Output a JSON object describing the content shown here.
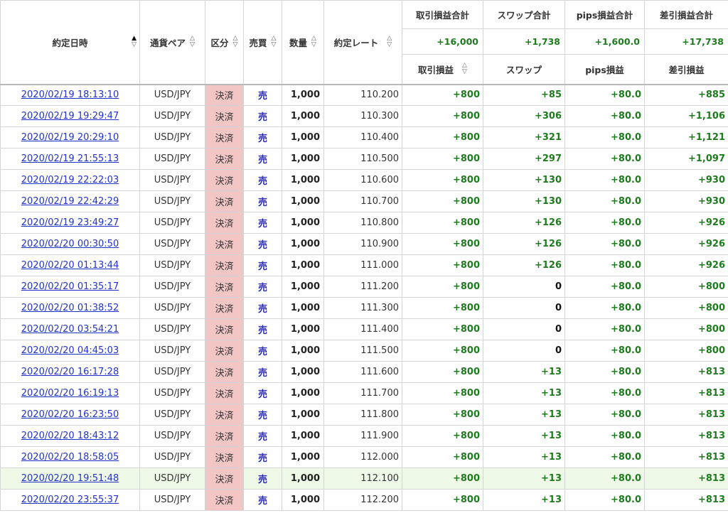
{
  "headers": {
    "date": "約定日時",
    "pair": "通貨ペア",
    "kubun": "区分",
    "baibai": "売買",
    "qty": "数量",
    "rate": "約定レート",
    "trade_pl_total": "取引損益合計",
    "swap_total": "スワップ合計",
    "pips_total": "pips損益合計",
    "net_total": "差引損益合計",
    "trade_pl": "取引損益",
    "swap": "スワップ",
    "pips": "pips損益",
    "net": "差引損益"
  },
  "sort_glyphs": {
    "up": "△",
    "down": "▽",
    "up_active": "▲"
  },
  "totals": {
    "trade_pl": "+16,000",
    "swap": "+1,738",
    "pips": "+1,600.0",
    "net": "+17,738"
  },
  "rows": [
    {
      "date": "2020/02/19 18:13:10",
      "pair": "USD/JPY",
      "kubun": "決済",
      "side": "売",
      "qty": "1,000",
      "rate": "110.200",
      "pl": "+800",
      "swap": "+85",
      "pips": "+80.0",
      "net": "+885"
    },
    {
      "date": "2020/02/19 19:29:47",
      "pair": "USD/JPY",
      "kubun": "決済",
      "side": "売",
      "qty": "1,000",
      "rate": "110.300",
      "pl": "+800",
      "swap": "+306",
      "pips": "+80.0",
      "net": "+1,106"
    },
    {
      "date": "2020/02/19 20:29:10",
      "pair": "USD/JPY",
      "kubun": "決済",
      "side": "売",
      "qty": "1,000",
      "rate": "110.400",
      "pl": "+800",
      "swap": "+321",
      "pips": "+80.0",
      "net": "+1,121"
    },
    {
      "date": "2020/02/19 21:55:13",
      "pair": "USD/JPY",
      "kubun": "決済",
      "side": "売",
      "qty": "1,000",
      "rate": "110.500",
      "pl": "+800",
      "swap": "+297",
      "pips": "+80.0",
      "net": "+1,097"
    },
    {
      "date": "2020/02/19 22:22:03",
      "pair": "USD/JPY",
      "kubun": "決済",
      "side": "売",
      "qty": "1,000",
      "rate": "110.600",
      "pl": "+800",
      "swap": "+130",
      "pips": "+80.0",
      "net": "+930"
    },
    {
      "date": "2020/02/19 22:42:29",
      "pair": "USD/JPY",
      "kubun": "決済",
      "side": "売",
      "qty": "1,000",
      "rate": "110.700",
      "pl": "+800",
      "swap": "+130",
      "pips": "+80.0",
      "net": "+930"
    },
    {
      "date": "2020/02/19 23:49:27",
      "pair": "USD/JPY",
      "kubun": "決済",
      "side": "売",
      "qty": "1,000",
      "rate": "110.800",
      "pl": "+800",
      "swap": "+126",
      "pips": "+80.0",
      "net": "+926"
    },
    {
      "date": "2020/02/20 00:30:50",
      "pair": "USD/JPY",
      "kubun": "決済",
      "side": "売",
      "qty": "1,000",
      "rate": "110.900",
      "pl": "+800",
      "swap": "+126",
      "pips": "+80.0",
      "net": "+926"
    },
    {
      "date": "2020/02/20 01:13:44",
      "pair": "USD/JPY",
      "kubun": "決済",
      "side": "売",
      "qty": "1,000",
      "rate": "111.000",
      "pl": "+800",
      "swap": "+126",
      "pips": "+80.0",
      "net": "+926"
    },
    {
      "date": "2020/02/20 01:35:17",
      "pair": "USD/JPY",
      "kubun": "決済",
      "side": "売",
      "qty": "1,000",
      "rate": "111.200",
      "pl": "+800",
      "swap": "0",
      "pips": "+80.0",
      "net": "+800"
    },
    {
      "date": "2020/02/20 01:38:52",
      "pair": "USD/JPY",
      "kubun": "決済",
      "side": "売",
      "qty": "1,000",
      "rate": "111.300",
      "pl": "+800",
      "swap": "0",
      "pips": "+80.0",
      "net": "+800"
    },
    {
      "date": "2020/02/20 03:54:21",
      "pair": "USD/JPY",
      "kubun": "決済",
      "side": "売",
      "qty": "1,000",
      "rate": "111.400",
      "pl": "+800",
      "swap": "0",
      "pips": "+80.0",
      "net": "+800"
    },
    {
      "date": "2020/02/20 04:45:03",
      "pair": "USD/JPY",
      "kubun": "決済",
      "side": "売",
      "qty": "1,000",
      "rate": "111.500",
      "pl": "+800",
      "swap": "0",
      "pips": "+80.0",
      "net": "+800"
    },
    {
      "date": "2020/02/20 16:17:28",
      "pair": "USD/JPY",
      "kubun": "決済",
      "side": "売",
      "qty": "1,000",
      "rate": "111.600",
      "pl": "+800",
      "swap": "+13",
      "pips": "+80.0",
      "net": "+813"
    },
    {
      "date": "2020/02/20 16:19:13",
      "pair": "USD/JPY",
      "kubun": "決済",
      "side": "売",
      "qty": "1,000",
      "rate": "111.700",
      "pl": "+800",
      "swap": "+13",
      "pips": "+80.0",
      "net": "+813"
    },
    {
      "date": "2020/02/20 16:23:50",
      "pair": "USD/JPY",
      "kubun": "決済",
      "side": "売",
      "qty": "1,000",
      "rate": "111.800",
      "pl": "+800",
      "swap": "+13",
      "pips": "+80.0",
      "net": "+813"
    },
    {
      "date": "2020/02/20 18:43:12",
      "pair": "USD/JPY",
      "kubun": "決済",
      "side": "売",
      "qty": "1,000",
      "rate": "111.900",
      "pl": "+800",
      "swap": "+13",
      "pips": "+80.0",
      "net": "+813"
    },
    {
      "date": "2020/02/20 18:58:05",
      "pair": "USD/JPY",
      "kubun": "決済",
      "side": "売",
      "qty": "1,000",
      "rate": "112.000",
      "pl": "+800",
      "swap": "+13",
      "pips": "+80.0",
      "net": "+813"
    },
    {
      "date": "2020/02/20 19:51:48",
      "pair": "USD/JPY",
      "kubun": "決済",
      "side": "売",
      "qty": "1,000",
      "rate": "112.100",
      "pl": "+800",
      "swap": "+13",
      "pips": "+80.0",
      "net": "+813",
      "highlighted": true
    },
    {
      "date": "2020/02/20 23:55:37",
      "pair": "USD/JPY",
      "kubun": "決済",
      "side": "売",
      "qty": "1,000",
      "rate": "112.200",
      "pl": "+800",
      "swap": "+13",
      "pips": "+80.0",
      "net": "+813"
    }
  ],
  "colors": {
    "positive": "#1e7b1e",
    "link": "#2233cc",
    "kubun_bg": "#f3c6c6",
    "sell": "#2a2ab8",
    "highlight_row": "#eef9e8"
  }
}
